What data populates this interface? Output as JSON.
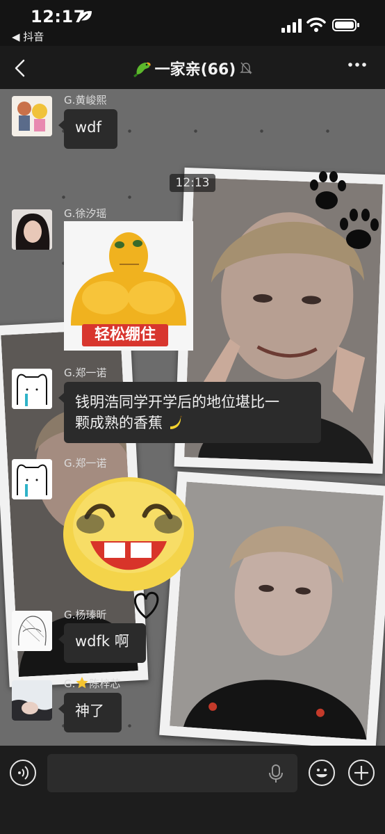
{
  "status_bar": {
    "time": "12:17",
    "back_app_label": "◀ 抖音"
  },
  "nav": {
    "group_name": "一家亲(66)"
  },
  "chat": {
    "timestamp": "12:13",
    "messages": [
      {
        "sender": "G.黄峻熙",
        "text": "wdf"
      },
      {
        "sender": "G.徐汐瑶",
        "sticker_caption": "轻松绷住"
      },
      {
        "sender": "G.郑一诺",
        "text_line1": "钱明浩同学开学后的地位堪比一",
        "text_line2": "颗成熟的香蕉"
      },
      {
        "sender": "G.郑一诺",
        "sticker": "laughing-face-sticker"
      },
      {
        "sender": "G.杨瑧昕",
        "text": "wdfk 啊"
      },
      {
        "sender_prefix": "G.",
        "sender_name": "陈梓芯",
        "text": "神了"
      }
    ]
  },
  "colors": {
    "bubble": "#2b2b2b",
    "chat_bg": "#6c6c6c",
    "bar_bg": "#1d1d1d"
  }
}
